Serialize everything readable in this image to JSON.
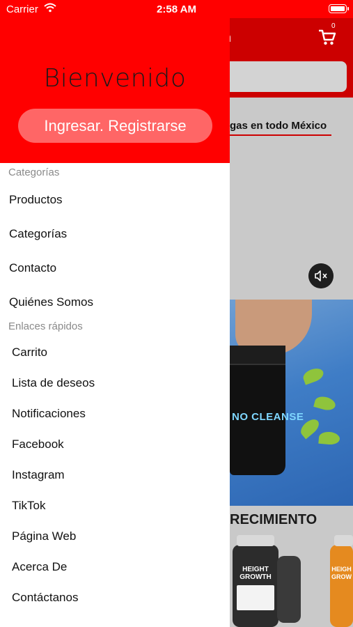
{
  "status_bar": {
    "carrier": "Carrier",
    "time": "2:58 AM"
  },
  "background": {
    "header_title": "n",
    "cart_count": "0",
    "promo_text": "gas en todo México",
    "banner_product": "NO CLEANSE",
    "section_title": "RECIMIENTO",
    "bottle_label": "HEIGHT GROWTH",
    "bottle_label_right": "HEIGH GROW"
  },
  "drawer": {
    "welcome": "Bienvenido",
    "login_button": "Ingresar. Registrarse",
    "categories_label": "Categorías",
    "category_items": [
      "Productos",
      "Categorías",
      "Contacto",
      "Quiénes Somos"
    ],
    "quick_links_label": "Enlaces rápidos",
    "quick_links": [
      "Carrito",
      "Lista de deseos",
      "Notificaciones",
      "Facebook",
      "Instagram",
      "TikTok",
      "Página Web",
      "Acerca De",
      "Contáctanos"
    ]
  },
  "colors": {
    "brand_red": "#ff0000",
    "header_red": "#cc0000",
    "button_pink": "#ff6666"
  },
  "icons": {
    "wifi": "wifi-icon",
    "battery": "battery-icon",
    "cart": "cart-icon",
    "mute": "mute-icon"
  }
}
